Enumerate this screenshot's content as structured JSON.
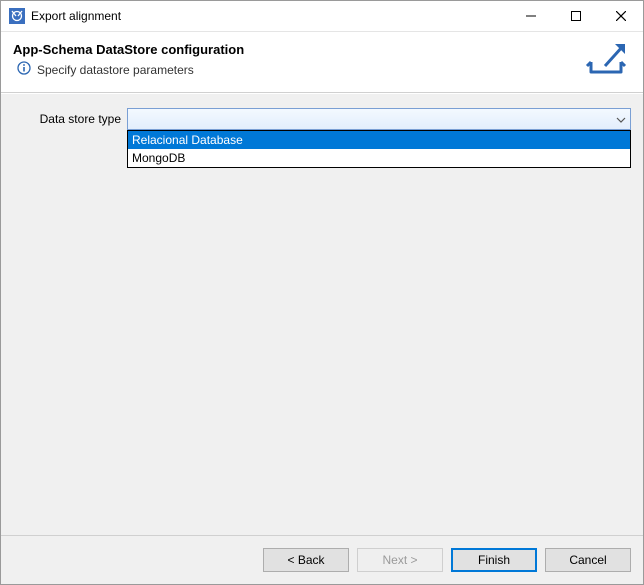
{
  "window": {
    "title": "Export alignment"
  },
  "banner": {
    "heading": "App-Schema DataStore configuration",
    "subtitle": "Specify datastore parameters"
  },
  "form": {
    "data_store_type_label": "Data store type",
    "data_store_type_value": "",
    "options": [
      {
        "label": "Relacional Database",
        "selected": true
      },
      {
        "label": "MongoDB",
        "selected": false
      }
    ]
  },
  "footer": {
    "back_label": "< Back",
    "next_label": "Next >",
    "finish_label": "Finish",
    "cancel_label": "Cancel"
  }
}
